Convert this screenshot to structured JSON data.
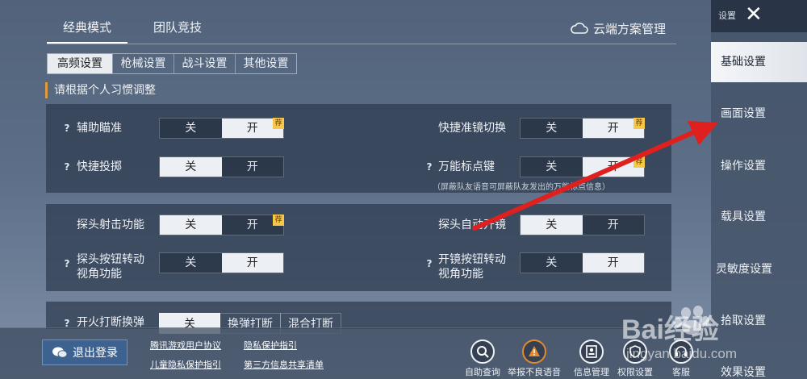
{
  "mode_tabs": [
    "经典模式",
    "团队竞技"
  ],
  "cloud_manage": "云端方案管理",
  "sub_tabs": [
    "高频设置",
    "枪械设置",
    "战斗设置",
    "其他设置"
  ],
  "hint": "请根据个人习惯调整",
  "toggle": {
    "off": "关",
    "on": "开",
    "rec": "荐"
  },
  "settings": {
    "aim_assist": "辅助瞄准",
    "quick_scope": "快捷准镜切换",
    "quick_throw": "快捷投掷",
    "universal_mark": "万能标点键",
    "mark_note": "（屏蔽队友语音可屏蔽队友发出的万能标点信息）",
    "peek_fire": "探头射击功能",
    "auto_peek": "探头自动开镜",
    "peek_rotate_l1": "探头按钮转动",
    "peek_rotate_l2": "视角功能",
    "scope_rotate_l1": "开镜按钮转动",
    "scope_rotate_l2": "视角功能",
    "fire_switch": "开火打断换弹",
    "fire_opts": [
      "关",
      "换弹打断",
      "混合打断"
    ]
  },
  "sidebar": {
    "title": "设置",
    "items": [
      "基础设置",
      "画面设置",
      "操作设置",
      "载具设置",
      "灵敏度设置",
      "拾取设置",
      "效果设置"
    ]
  },
  "bottom": {
    "logout": "退出登录",
    "links": [
      "腾讯游戏用户协议",
      "隐私保护指引",
      "儿童隐私保护指引",
      "第三方信息共享清单"
    ],
    "buttons": [
      "自助查询",
      "举报不良语音",
      "信息管理",
      "权限设置",
      "客服"
    ]
  },
  "watermark": {
    "brand": "Bai经验",
    "url": "jingyan.baidu.com"
  }
}
